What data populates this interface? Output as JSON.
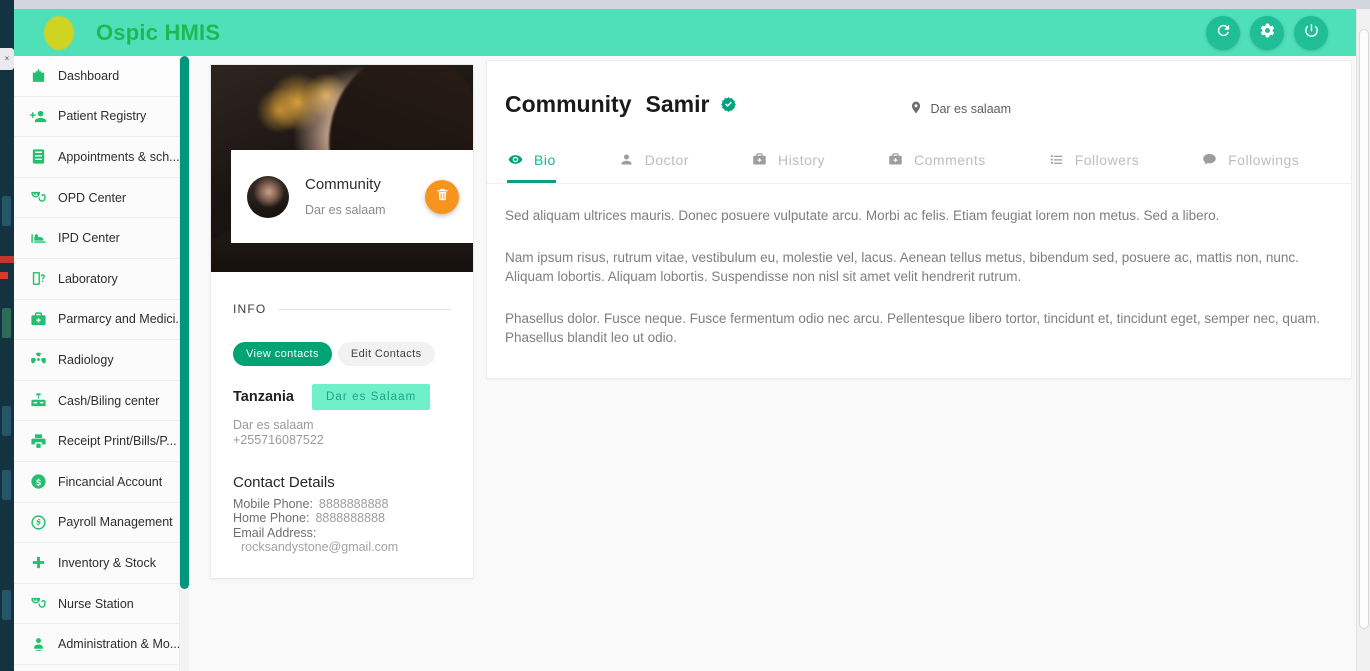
{
  "header": {
    "brand": "Ospic HMIS",
    "logo_icon": "logo-dot-icon",
    "actions": [
      {
        "name": "refresh-button",
        "icon": "refresh-icon"
      },
      {
        "name": "settings-button",
        "icon": "gear-icon"
      },
      {
        "name": "power-button",
        "icon": "power-icon"
      }
    ]
  },
  "sidebar": {
    "items": [
      {
        "label": "Dashboard",
        "icon": "hospital-icon"
      },
      {
        "label": "Patient Registry",
        "icon": "add-user-icon"
      },
      {
        "label": "Appointments & sch...",
        "icon": "calendar-icon"
      },
      {
        "label": "OPD Center",
        "icon": "stethoscope-icon"
      },
      {
        "label": "IPD Center",
        "icon": "bed-icon"
      },
      {
        "label": "Laboratory",
        "icon": "lab-flask-icon"
      },
      {
        "label": "Parmarcy and Medici...",
        "icon": "medkit-icon"
      },
      {
        "label": "Radiology",
        "icon": "radiation-icon"
      },
      {
        "label": "Cash/Biling center",
        "icon": "cash-register-icon"
      },
      {
        "label": "Receipt Print/Bills/P...",
        "icon": "printer-icon"
      },
      {
        "label": "Fincancial Account",
        "icon": "money-coin-icon"
      },
      {
        "label": "Payroll Management",
        "icon": "dollar-circle-icon"
      },
      {
        "label": "Inventory & Stock",
        "icon": "plus-icon"
      },
      {
        "label": "Nurse Station",
        "icon": "stethoscope-icon"
      },
      {
        "label": "Administration & Mo...",
        "icon": "user-admin-icon"
      }
    ]
  },
  "profile_card": {
    "avatar_icon": "avatar",
    "name": "Community",
    "location": "Dar es salaam",
    "delete_icon": "trash-icon",
    "info_label": "INFO",
    "buttons": {
      "view_contacts": "View contacts",
      "edit_contacts": "Edit Contacts"
    },
    "country": "Tanzania",
    "city_badge": "Dar es Salaam",
    "address": "Dar es salaam",
    "phone": "+255716087522",
    "contact_details_title": "Contact Details",
    "contacts": [
      {
        "key": "Mobile Phone:",
        "value": "8888888888"
      },
      {
        "key": "Home Phone:",
        "value": "8888888888"
      }
    ],
    "email_label": "Email Address:",
    "email_value": "rocksandystone@gmail.com"
  },
  "content": {
    "title_first": "Community",
    "title_last": "Samir",
    "verified_icon": "verified-badge-icon",
    "location_icon": "map-pin-icon",
    "location": "Dar es salaam",
    "tabs": [
      {
        "label": "Bio",
        "icon": "eye-icon",
        "active": true
      },
      {
        "label": "Doctor",
        "icon": "user-icon",
        "active": false
      },
      {
        "label": "History",
        "icon": "medkit-icon",
        "active": false
      },
      {
        "label": "Comments",
        "icon": "medkit-icon",
        "active": false
      },
      {
        "label": "Followers",
        "icon": "list-icon",
        "active": false
      },
      {
        "label": "Followings",
        "icon": "chat-bubble-icon",
        "active": false
      }
    ],
    "bio_paragraphs": [
      "Sed aliquam ultrices mauris. Donec posuere vulputate arcu. Morbi ac felis. Etiam feugiat lorem non metus. Sed a libero.",
      "Nam ipsum risus, rutrum vitae, vestibulum eu, molestie vel, lacus. Aenean tellus metus, bibendum sed, posuere ac, mattis non, nunc. Aliquam lobortis. Aliquam lobortis. Suspendisse non nisl sit amet velit hendrerit rutrum.",
      "Phasellus dolor. Fusce neque. Fusce fermentum odio nec arcu. Pellentesque libero tortor, tincidunt et, tincidunt eget, semper nec, quam. Phasellus blandit leo ut odio."
    ]
  },
  "colors": {
    "header_bg": "#4fe0b9",
    "brand_text": "#1db954",
    "accent_teal": "#00a07f",
    "sidebar_icon": "#22c06e",
    "delete_orange": "#f7941d",
    "badge_mint": "#6ff0c9",
    "scroll_teal": "#00967b"
  }
}
